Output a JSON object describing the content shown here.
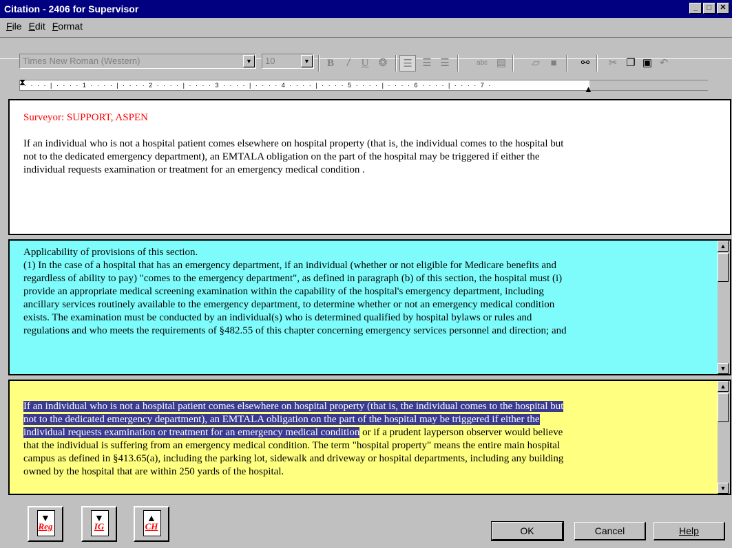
{
  "window": {
    "title": "Citation - 2406 for Supervisor",
    "controls": [
      "_",
      "□",
      "✕"
    ]
  },
  "menu": [
    "File",
    "Edit",
    "Format"
  ],
  "toolbar": {
    "font_name": "Times New Roman (Western)",
    "font_size": "10",
    "icons": [
      "bold-icon",
      "italic-icon",
      "underline-icon",
      "color-icon",
      "align-left-icon",
      "align-center-icon",
      "align-right-icon",
      "spellcheck-icon",
      "book-icon",
      "open-icon",
      "save-icon",
      "find-icon",
      "cut-icon",
      "copy-icon",
      "paste-icon",
      "undo-icon"
    ]
  },
  "ruler": {
    "ticks": "· · · · | · · · · 1 · · · · | · · · · 2 · · · · | · · · · 3 · · · · | · · · · 4 · · · · | · · · · 5 · · · · | · · · · 6 · · · · | · · · · 7 ·"
  },
  "pane1": {
    "surveyor": "Surveyor: SUPPORT, ASPEN",
    "text": "If an individual who is not a hospital patient comes elsewhere on hospital property (that is, the individual comes to the hospital but not to the dedicated emergency department), an EMTALA obligation on the part of the hospital may be triggered if either the individual requests examination or treatment for an emergency medical condition ."
  },
  "pane2": {
    "heading": "Applicability of provisions of this section.",
    "text": "(1) In the case of a hospital that has an emergency department, if an individual (whether or not eligible for Medicare benefits and regardless of ability to pay) \"comes to the emergency department\", as defined in paragraph (b) of this section, the hospital must  (i) provide an appropriate medical screening examination within the capability of the hospital's emergency department, including ancillary services routinely available to the emergency department, to determine whether or not an emergency medical condition exists.  The examination must be conducted by an individual(s) who is determined qualified by hospital bylaws or rules and regulations and who meets the requirements of §482.55 of this chapter concerning emergency services personnel and direction; and"
  },
  "pane3": {
    "selected_text": "If an individual who is not a hospital patient comes elsewhere on hospital property (that is, the individual comes to the hospital but not to the dedicated emergency department), an EMTALA obligation on the part of the hospital may be triggered if either the individual requests examination or treatment for an emergency medical condition",
    "rest_text": " or if a prudent layperson observer would believe that the individual is suffering from an emergency medical condition. The term \"hospital property\" means the entire main hospital campus as defined in §413.65(a), including the parking lot, sidewalk and driveway or hospital departments, including any building owned by the hospital that are within 250 yards of the hospital."
  },
  "buttons": {
    "reg": "Reg",
    "ig": "IG",
    "ch": "CH",
    "ok": "OK",
    "cancel": "Cancel",
    "help": "Help"
  },
  "colors": {
    "title_bar": "#000080",
    "pane2_bg": "#7efcfc",
    "pane3_bg": "#ffff80",
    "surveyor": "#ff0000",
    "selection": "#3a3a90"
  }
}
